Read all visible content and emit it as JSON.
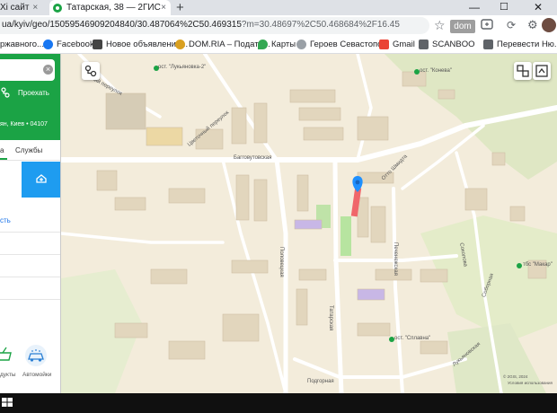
{
  "browser": {
    "tabs": [
      {
        "label": "Xi сайт",
        "close": "×"
      },
      {
        "label": "Татарская, 38 — 2ГИС",
        "close": "×"
      }
    ],
    "new_tab": "+",
    "window_controls": {
      "minimize": "—",
      "maximize": "☐",
      "close": "✕"
    },
    "url_main": "ua/kyiv/geo/15059546909204840/30.487064%2C50.469315",
    "url_rest": "?m=30.48697%2C50.468684%2F16.45",
    "dom_extension": "dom",
    "bookmarks": [
      {
        "label": "ржавного...",
        "color": "#6d8fb3"
      },
      {
        "label": "Facebook",
        "color": "#1877f2"
      },
      {
        "label": "Новое объявление...",
        "color": "#444444"
      },
      {
        "label": "DOM.RIA – Подати...",
        "color": "#d9a020"
      },
      {
        "label": "Карты",
        "color": "#34a853"
      },
      {
        "label": "Героев Севастопо...",
        "color": "#9aa0a6"
      },
      {
        "label": "Gmail",
        "color": "#ea4335"
      },
      {
        "label": "SCANBOO",
        "color": "#5f6368"
      },
      {
        "label": "Перевести Ню...",
        "color": "#5f6368"
      }
    ]
  },
  "panel": {
    "route_label": "Проехать",
    "address": "ян, Киев • 04107",
    "tabs": [
      "а",
      "Службы"
    ],
    "link_more": "сть",
    "bottom_items": [
      {
        "label": "дукты",
        "icon": "basket-icon"
      },
      {
        "label": "Автомойки",
        "icon": "car-wash-icon"
      }
    ]
  },
  "map": {
    "street_labels": {
      "baggoutovskaya": "Багговутовская",
      "tatarskaya": "Татарская",
      "pechenegskaya": "Печенежская",
      "polovetskaya": "Половецкая",
      "otto_shmidta": "Отто Шмидта",
      "tsvetkovy": "Цветочный переулок",
      "tikhiy": "Тихий переулок",
      "podgornaya": "Подгорная",
      "sokolova": "Соколова",
      "soboriy_yar": "Соборная",
      "mykhyrinskaya": "Лукьяновская"
    },
    "stop_labels": {
      "stop1": "ост. \"Лукьяновка-2\"",
      "stop2": "ост. \"Конева\"",
      "stop3": "ост. \"Сплавна\"",
      "stop4": "тбс \"Макар\""
    },
    "copyright_line1": "© 2GIS, 2024",
    "copyright_line2": "Условия использования"
  },
  "colors": {
    "brand_green": "#1ba345",
    "info_blue": "#1e9cf0",
    "route_red": "#f0666a",
    "marker_blue": "#1e90ff"
  }
}
